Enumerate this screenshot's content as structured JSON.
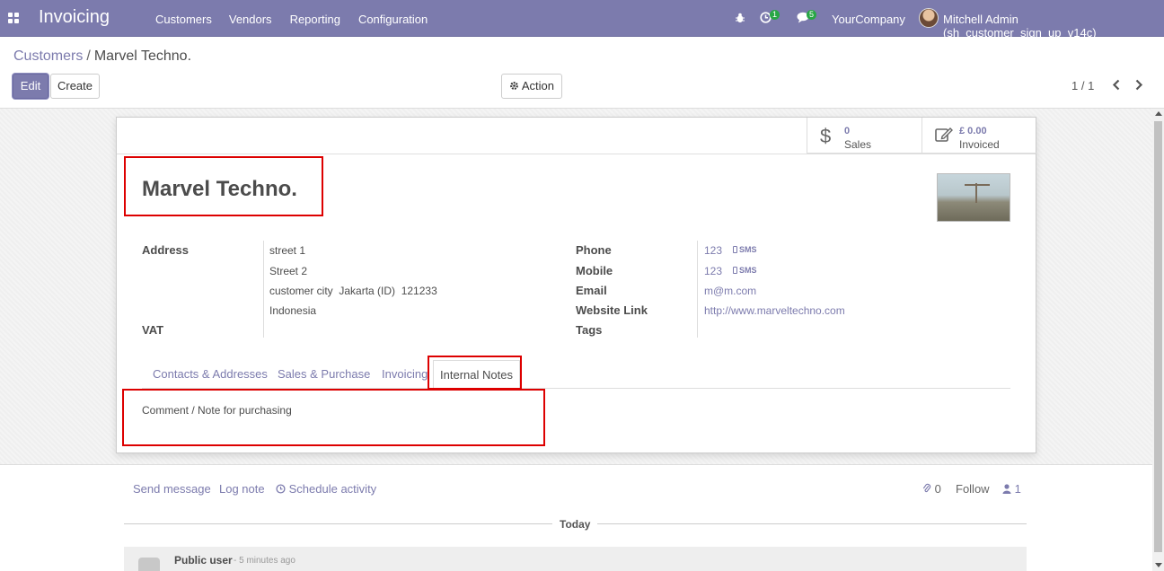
{
  "navbar": {
    "app_name": "Invoicing",
    "menu": [
      "Customers",
      "Vendors",
      "Reporting",
      "Configuration"
    ],
    "activity_badge": "1",
    "message_badge": "5",
    "company": "YourCompany",
    "user": "Mitchell Admin (sh_customer_sign_up_v14c)"
  },
  "breadcrumb": {
    "parent": "Customers",
    "separator": "/",
    "current": "Marvel Techno."
  },
  "buttons": {
    "edit": "Edit",
    "create": "Create",
    "action": "Action"
  },
  "pager": {
    "value": "1 / 1"
  },
  "smart_buttons": [
    {
      "value": "0",
      "label": "Sales",
      "icon": "dollar-icon"
    },
    {
      "value": "£ 0.00",
      "label": "Invoiced",
      "icon": "pencil-square-icon"
    }
  ],
  "record": {
    "name": "Marvel Techno.",
    "address_label": "Address",
    "street": "street 1",
    "street2": "Street 2",
    "city_line": "customer city  Jakarta (ID)  121233",
    "country": "Indonesia",
    "vat_label": "VAT",
    "phone_label": "Phone",
    "phone": "123",
    "mobile_label": "Mobile",
    "mobile": "123",
    "sms_label": "SMS",
    "email_label": "Email",
    "email": "m@m.com",
    "website_label": "Website Link",
    "website": "http://www.marveltechno.com",
    "tags_label": "Tags"
  },
  "tabs": {
    "contacts": "Contacts & Addresses",
    "sales_purchase": "Sales & Purchase",
    "invoicing": "Invoicing",
    "internal_notes": "Internal Notes"
  },
  "notes": {
    "text": "Comment / Note for purchasing"
  },
  "chatter": {
    "send_message": "Send message",
    "log_note": "Log note",
    "schedule_activity": "Schedule activity",
    "attachments_count": "0",
    "follow": "Follow",
    "followers_count": "1",
    "date_separator": "Today",
    "message_author": "Public user",
    "message_time": "- 5 minutes ago"
  },
  "colors": {
    "brand": "#7c7bad",
    "highlight": "#dd0000"
  }
}
